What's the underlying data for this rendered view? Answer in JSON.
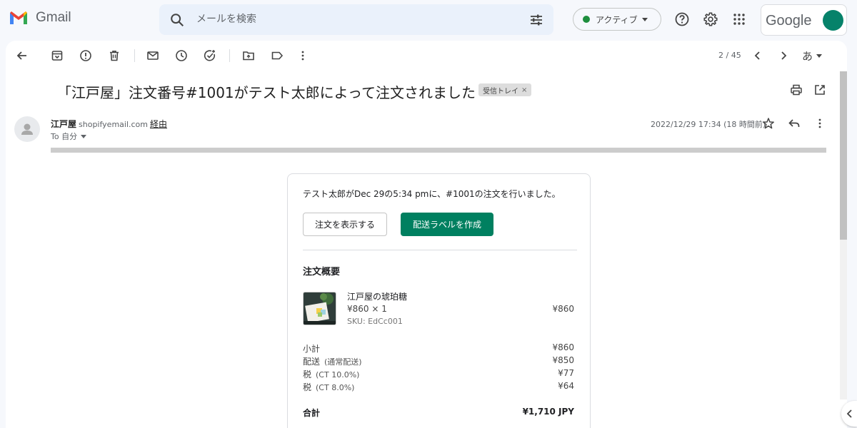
{
  "app": {
    "name": "Gmail",
    "account_brand": "Google"
  },
  "search": {
    "placeholder": "メールを検索"
  },
  "status": {
    "label": "アクティブ",
    "color": "#1e8e3e"
  },
  "toolbar": {
    "pager": "2 / 45",
    "input_tool": "あ"
  },
  "email": {
    "subject": "「江戸屋」注文番号#1001がテスト太郎によって注文されました",
    "label": "受信トレイ",
    "label_remove": "×",
    "sender_name": "江戸屋",
    "sender_via_domain": "shopifyemail.com",
    "sender_via": "経由",
    "to": "To 自分",
    "date": "2022/12/29 17:34 (18 時間前)"
  },
  "order": {
    "intro": "テスト太郎がDec 29の5:34 pmに、#1001の注文を行いました。",
    "view_button": "注文を表示する",
    "label_button": "配送ラベルを作成",
    "summary_title": "注文概要",
    "item": {
      "name": "江戸屋の琥珀糖",
      "qty": "¥860 × 1",
      "sku": "SKU: EdCc001",
      "price": "¥860"
    },
    "subtotal": {
      "label": "小計",
      "sub": "",
      "value": "¥860"
    },
    "shipping": {
      "label": "配送",
      "sub": "(通常配送)",
      "value": "¥850"
    },
    "tax10": {
      "label": "税",
      "sub": "(CT 10.0%)",
      "value": "¥77"
    },
    "tax8": {
      "label": "税",
      "sub": "(CT 8.0%)",
      "value": "¥64"
    },
    "total": {
      "label": "合計",
      "value": "¥1,710 JPY"
    }
  },
  "colors": {
    "accent": "#008060",
    "avatar": "#06826a"
  }
}
